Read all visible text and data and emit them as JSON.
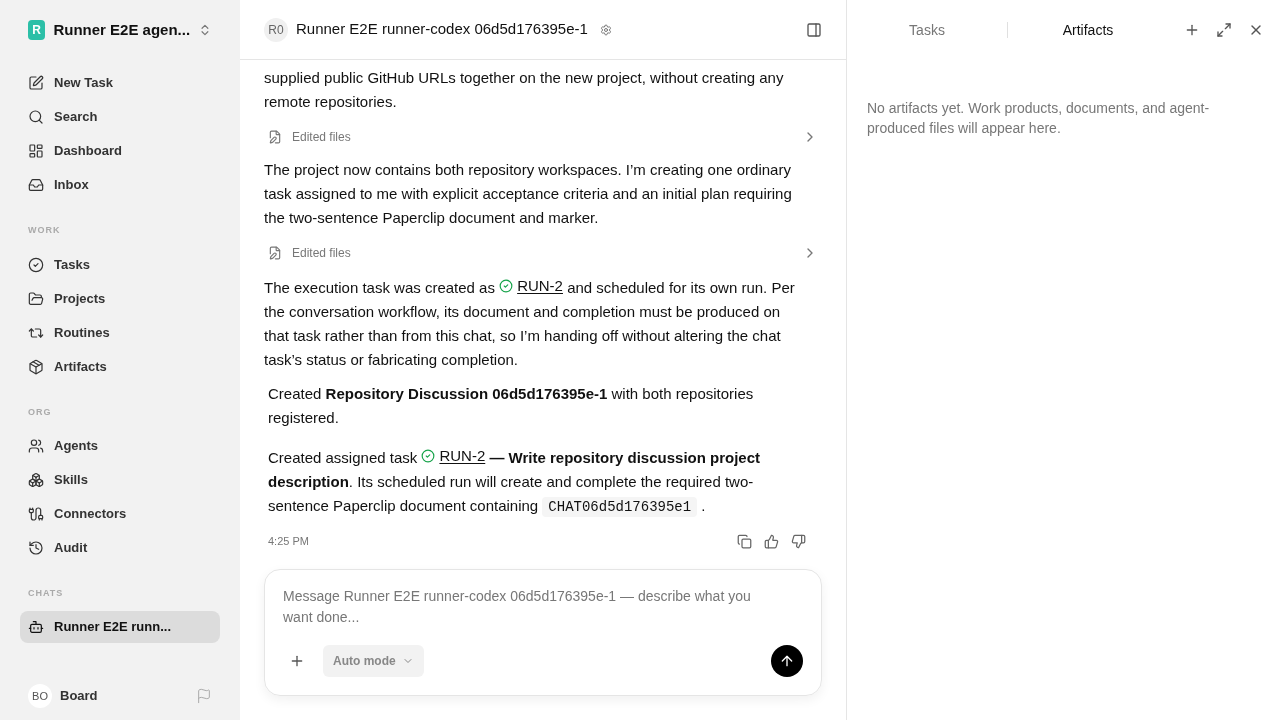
{
  "workspace": {
    "logo_letter": "R",
    "name": "Runner E2E agen..."
  },
  "nav": [
    {
      "label": "New Task"
    },
    {
      "label": "Search"
    },
    {
      "label": "Dashboard"
    },
    {
      "label": "Inbox"
    }
  ],
  "sections": [
    {
      "title": "WORK",
      "items": [
        {
          "label": "Tasks"
        },
        {
          "label": "Projects"
        },
        {
          "label": "Routines"
        },
        {
          "label": "Artifacts"
        }
      ]
    },
    {
      "title": "ORG",
      "items": [
        {
          "label": "Agents"
        },
        {
          "label": "Skills"
        },
        {
          "label": "Connectors"
        },
        {
          "label": "Audit"
        }
      ]
    }
  ],
  "chats": {
    "title": "CHATS",
    "items": [
      {
        "label": "Runner E2E runn...",
        "selected": true
      }
    ]
  },
  "user": {
    "initials": "BO",
    "name": "Board"
  },
  "header": {
    "initials": "R0",
    "title": "Runner E2E runner-codex 06d5d176395e-1"
  },
  "messages": [
    {
      "kind": "paragraph",
      "segments": [
        {
          "kind": "text",
          "text": "supplied public GitHub URLs together on the new project, without creating any remote repositories."
        }
      ]
    },
    {
      "kind": "edited",
      "label": "Edited files"
    },
    {
      "kind": "paragraph",
      "segments": [
        {
          "kind": "text",
          "text": "The project now contains both repository workspaces. I’m creating one ordinary task assigned to me with explicit acceptance criteria and an initial plan requiring the two-sentence Paperclip document and marker."
        }
      ]
    },
    {
      "kind": "edited",
      "label": "Edited files"
    },
    {
      "kind": "paragraph",
      "segments": [
        {
          "kind": "text",
          "text": "The execution task was created as "
        },
        {
          "kind": "task",
          "text": "RUN-2"
        },
        {
          "kind": "text",
          "text": " and scheduled for its own run. Per the conversation workflow, its document and completion must be produced on that task rather than from this chat, so I’m handing off without altering the chat task’s status or fabricating completion."
        }
      ]
    },
    {
      "kind": "summary",
      "segments": [
        {
          "kind": "text",
          "text": "Created **Repository Discussion 06d5d176395e-1** with both repositories registered."
        }
      ]
    },
    {
      "kind": "summary",
      "segments": [
        {
          "kind": "text",
          "text": "Created assigned task "
        },
        {
          "kind": "task",
          "text": "RUN-2"
        },
        {
          "kind": "text",
          "text": " **— Write repository discussion project description**. Its scheduled run will create and complete the required two-sentence Paperclip document containing "
        },
        {
          "kind": "code",
          "text": "CHAT06d5d176395e1"
        },
        {
          "kind": "text",
          "text": " ."
        }
      ]
    }
  ],
  "timestamp": "4:25 PM",
  "composer": {
    "placeholder": "Message Runner E2E runner-codex 06d5d176395e-1 — describe what you want done...",
    "mode": "Auto mode"
  },
  "panel": {
    "tabs": [
      {
        "label": "Tasks",
        "selected": false
      },
      {
        "label": "Artifacts",
        "selected": true
      }
    ],
    "empty_text": "No artifacts yet. Work products, documents, and agent-produced files will appear here."
  }
}
